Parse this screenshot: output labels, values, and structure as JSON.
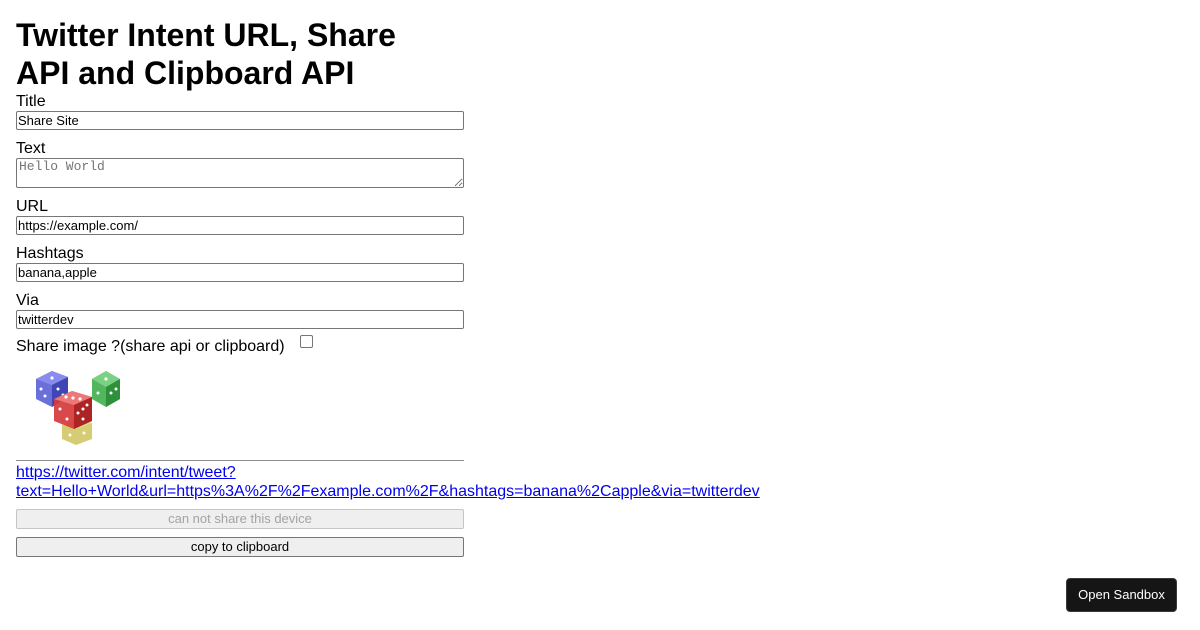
{
  "page_title_line1": "Twitter Intent URL, Share",
  "page_title_line2": "API and Clipboard API",
  "form": {
    "title": {
      "label": "Title",
      "value": "Share Site"
    },
    "text": {
      "label": "Text",
      "placeholder": "Hello World"
    },
    "url": {
      "label": "URL",
      "value": "https://example.com/"
    },
    "hashtags": {
      "label": "Hashtags",
      "value": "banana,apple"
    },
    "via": {
      "label": "Via",
      "value": "twitterdev"
    },
    "share_image": {
      "label": "Share image ?(share api or clipboard)",
      "checked": false
    }
  },
  "preview_image": {
    "icon": "dice-image"
  },
  "intent_link": {
    "line1": "https://twitter.com/intent/tweet?",
    "line2": "text=Hello+World&url=https%3A%2F%2Fexample.com%2F&hashtags=banana%2Capple&via=twitterdev"
  },
  "buttons": {
    "share_label": "can not share this device",
    "copy_label": "copy to clipboard",
    "sandbox_label": "Open Sandbox"
  },
  "colors": {
    "link": "#0000ee",
    "sandbox_bg": "#151515",
    "disabled_text": "#a3a3a3"
  }
}
